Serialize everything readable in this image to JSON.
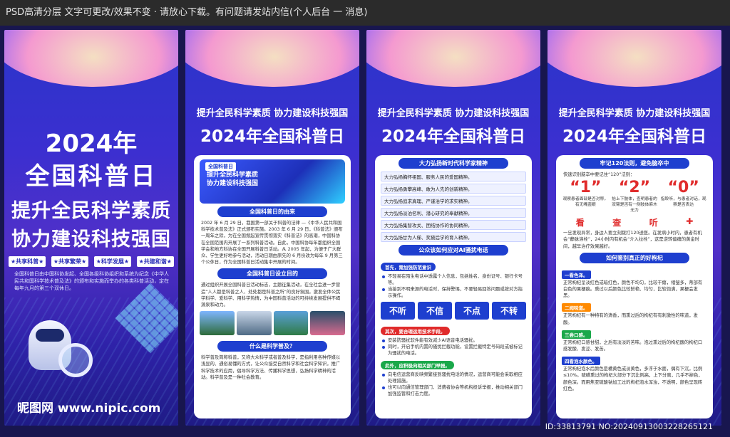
{
  "topbar": {
    "text": "PSD高清分层 文字可更改/效果不变 · 请放心下载。有问题请发站内信(个人后台 一 消息)"
  },
  "panel1": {
    "year": "2024年",
    "title": "全国科普日",
    "line2": "提升全民科学素质",
    "line3": "协力建设科技强国",
    "tags": [
      "★共享科普★",
      "★共享繁荣★",
      "★科学发展★",
      "★共建和谐★"
    ],
    "desc": "全国科普日由中国科协发起、全国各级科协组织和系统为纪念《中华人民共和国科学技术普及法》的颁布和实施而举办的各类科普活动，定在每年九月的第三个双休日。",
    "logo": "昵图网 www.nipic.com"
  },
  "header": {
    "sub": "提升全民科学素质 协力建设科技强国",
    "main": "2024年全国科普日"
  },
  "panel2": {
    "hero_tag": "全国科普日",
    "hero_line1": "提升全民科学素质",
    "hero_line2": "协力建设科技强国",
    "s1": "全国科普日的由来",
    "p1": "2002 年 6 月 29 日，我国第一部关于科普的法律 —《中华人民共和国科学技术普及法》正式颁布实施。2003 年 6 月 29 日，《科普法》颁布一周年之际，为在全国掀起宣传贯彻落实《科普法》的高潮，中国科协在全国范围内开展了一系列科普活动。自此，中国科协每年都组织全国学会和地方科协在全国开展科普日活动。从 2005 年起，为便于广大群众、学生更好地参与活动，活动日期由原先的 6 月份改为每年 9 月第三个公休日，作为全国科普日活动集中开展的时间。",
    "s2": "全国科普日设立目的",
    "p2": "通过组织开展全国科普日活动标志，主题征集活动，在全社会进一步营造“人人都是科普之人、处处都是科普之所”的良好氛围。激发全体公民学科学、爱科学、用科学热情，为中国科普活动的可持续发展提供不竭源泉和动力。",
    "s3": "什么是科学普及？",
    "p3": "科学普及简称科普，又称大众科学或者普及科学，是指利用各种传媒以浅显的、通俗易懂的方式，让公众接受自然科学和社会科学知识，推广科学技术的应用，倡导科学方法、传播科学思想，弘扬科学精神的活动。科学普及是一种社会教育。"
  },
  "panel3": {
    "s1": "大力弘扬新时代科学家精神",
    "list": [
      "大力弘扬胸怀祖国、服务人民的爱国精神。",
      "大力弘扬勇攀高峰、敢为人先的创新精神。",
      "大力弘扬追求真理、严谨治学的求实精神。",
      "大力弘扬淡泊名利、潜心研究的奉献精神。",
      "大力弘扬集智攻关、团结协作的协同精神。",
      "大力弘扬甘为人梯、奖掖后学的育人精神。"
    ],
    "s2": "公众该如何应对AI骚扰电话",
    "step1": "首先，需加强防范意识",
    "b1": "不轻易在陌生电话中透露个人信息，包括姓名、身份证号、银行卡号等。",
    "b2": "当接到不明来源的电话时，保持警惕，不要轻易回答问题或按对方指示操作。",
    "buttons": [
      "不听",
      "不信",
      "不点",
      "不转"
    ],
    "step2": "其次，要合理运用技术手段。",
    "b3": "安装防骚扰软件能有效减少AI语音电话骚扰。",
    "b4": "同时，开启手机内置的骚扰拦截功能，设置拦截特定号码段或被标记为骚扰的电话。",
    "step3": "此外，应积极向相关部门举报。",
    "b5": "向电信运营商反映频繁接到骚扰电话的情况，运营商可能会采取相应处理措施。",
    "b6": "也可以向通信管理部门、消费者协会等机构投诉举报，推动相关部门加强监管和打击力度。"
  },
  "panel4": {
    "s1": "牢记120法则，避免脑卒中",
    "intro": "快速识别脑卒中要记住“120”法则：",
    "rules": [
      {
        "num": "“1”",
        "text": "观察患者面部是否对称，有无嘴歪眼"
      },
      {
        "num": "“2”",
        "text": "抬上下肢体，查明患者的双臂是否有一侧肢体麻木无力"
      },
      {
        "num": "“0”",
        "text": "指聆听，与患者对话，观察是否表达"
      }
    ],
    "icons": [
      "看",
      "查",
      "听"
    ],
    "p1": "一旦发现异常，身边人要立刻拨打120送医。在发病小时内，患者有机会“静脉溶栓”，24小时内有机会“介入拉栓”，这是逆转偏瘫的黄金时间，越早治疗效果越好。",
    "s2": "如何鉴别真正的好枸杞",
    "labels": [
      "一看色泽。",
      "二闻味道。",
      "三尝口感。",
      "四看泡水颜色。"
    ],
    "t1": "正常枸杞呈淡红色或暗红色，颜色不均匀，比较干瘪，褶皱多，蒂部有白色的果梗痕。熏过以后颜色比较鲜艳、均匀，比较饱满，果梗会发黑。",
    "t2": "正常枸杞有一种特有的清香，而熏过后的枸杞有有刺激性的味道，发酸。",
    "t3": "正常枸杞口感甘甜，之后有淡淡的苦味。泡过熏过后的枸杞酸的枸杞口感发酸、发涩、发苦。",
    "t4": "正常枸杞泡水后颜色是橘黄色或淡黄色，多浮于水面，偶有下沉，比例≤10%。硫磺熏过的枸杞大部分下沉比例高，上下分离，几乎不掉色，颜色深。而用焦亚硫酸钠加工过的枸杞泡水浑浊，不透明，颜色呈现砖红色。",
    "id": "ID:33813791 NO:20240913003228265121"
  },
  "colors": {
    "accent": "#1e3fcf",
    "red": "#e02b2b",
    "green": "#1aa84a",
    "orange": "#ff8a00"
  }
}
